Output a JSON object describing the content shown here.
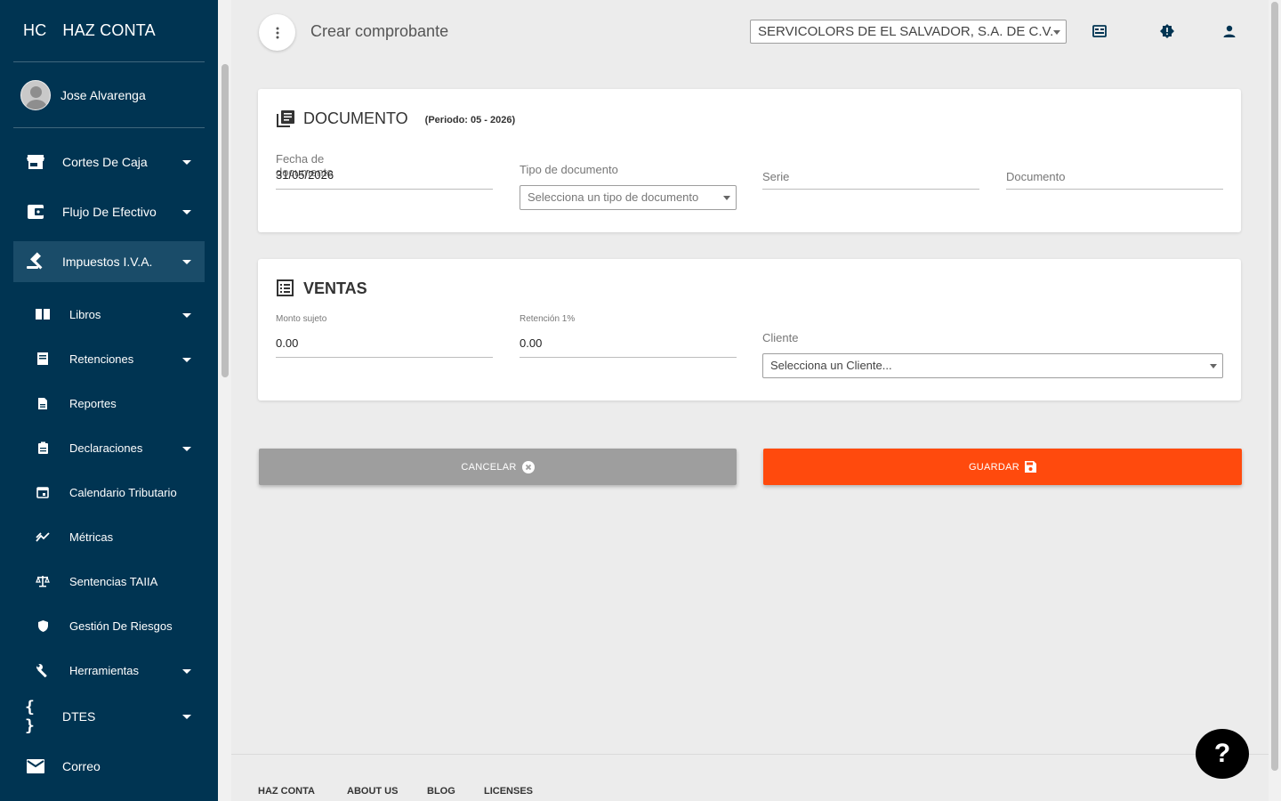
{
  "brand": {
    "short": "HC",
    "name": "HAZ CONTA"
  },
  "user": {
    "name": "Jose Alvarenga"
  },
  "sidebar": {
    "items": [
      {
        "label": "Cortes De Caja",
        "icon": "store-icon"
      },
      {
        "label": "Flujo De Efectivo",
        "icon": "wallet-icon"
      },
      {
        "label": "Impuestos I.V.A.",
        "icon": "gavel-icon"
      },
      {
        "label": "Libros",
        "icon": "book-icon"
      },
      {
        "label": "Retenciones",
        "icon": "receipt-icon"
      },
      {
        "label": "Reportes",
        "icon": "document-icon"
      },
      {
        "label": "Declaraciones",
        "icon": "clipboard-icon"
      },
      {
        "label": "Calendario Tributario",
        "icon": "calendar-icon"
      },
      {
        "label": "Métricas",
        "icon": "trend-icon"
      },
      {
        "label": "Sentencias TAIIA",
        "icon": "scale-icon"
      },
      {
        "label": "Gestión De Riesgos",
        "icon": "shield-icon"
      },
      {
        "label": "Herramientas",
        "icon": "wrench-icon"
      },
      {
        "label": "DTES",
        "icon": "braces-icon"
      },
      {
        "label": "Correo",
        "icon": "mail-icon"
      }
    ]
  },
  "header": {
    "title": "Crear comprobante",
    "company": "SERVICOLORS DE EL SALVADOR, S.A. DE C.V."
  },
  "documento": {
    "title": "DOCUMENTO",
    "period": "(Periodo: 05 - 2026)",
    "fecha_label": "Fecha de documento",
    "fecha_value": "31/05/2026",
    "tipo_label": "Tipo de documento",
    "tipo_placeholder": "Selecciona un tipo de documento",
    "serie_label": "Serie",
    "documento_label": "Documento"
  },
  "ventas": {
    "title": "VENTAS",
    "monto_label": "Monto sujeto",
    "monto_value": "0.00",
    "retencion_label": "Retención 1%",
    "retencion_value": "0.00",
    "cliente_label": "Cliente",
    "cliente_placeholder": "Selecciona un Cliente..."
  },
  "actions": {
    "cancel": "CANCELAR",
    "save": "GUARDAR"
  },
  "footer": {
    "links": [
      "HAZ CONTA",
      "ABOUT US",
      "BLOG",
      "LICENSES"
    ]
  },
  "help": {
    "label": "?"
  },
  "colors": {
    "sidebar": "#003452",
    "accent": "#ff4a0d",
    "cancel": "#9e9e9e"
  }
}
